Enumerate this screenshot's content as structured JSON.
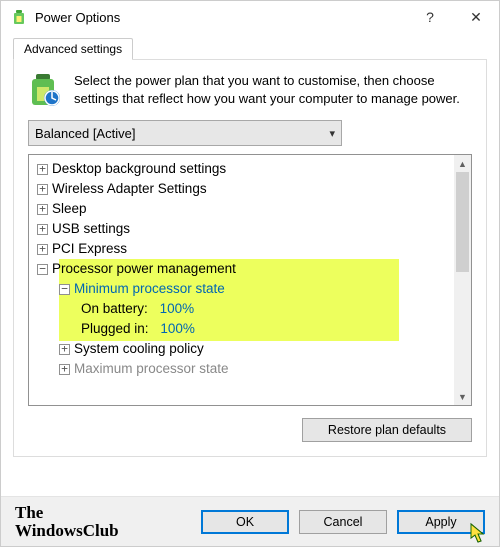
{
  "window": {
    "title": "Power Options",
    "help_label": "?",
    "close_label": "✕"
  },
  "tab": {
    "label": "Advanced settings"
  },
  "intro": "Select the power plan that you want to customise, then choose settings that reflect how you want your computer to manage power.",
  "plan_selector": {
    "value": "Balanced [Active]"
  },
  "tree": {
    "desktop_bg": "Desktop background settings",
    "wireless": "Wireless Adapter Settings",
    "sleep": "Sleep",
    "usb": "USB settings",
    "pci": "PCI Express",
    "proc_mgmt": "Processor power management",
    "min_state": "Minimum processor state",
    "on_battery_label": "On battery:",
    "on_battery_value": "100%",
    "plugged_label": "Plugged in:",
    "plugged_value": "100%",
    "cooling": "System cooling policy",
    "max_state_cut": "Maximum processor state"
  },
  "buttons": {
    "restore": "Restore plan defaults",
    "ok": "OK",
    "cancel": "Cancel",
    "apply": "Apply"
  },
  "watermark": {
    "line1": "The",
    "line2": "WindowsClub"
  }
}
